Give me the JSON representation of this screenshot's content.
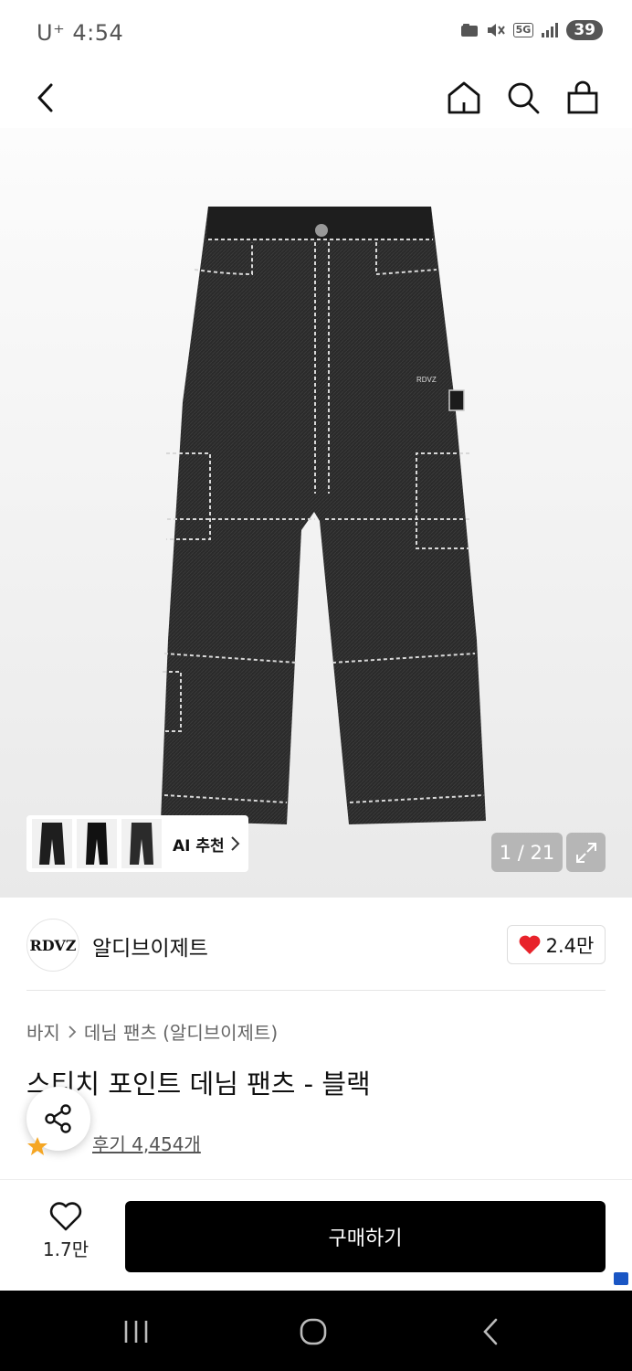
{
  "status_bar": {
    "time": "U⁺ 4:54",
    "network": "5G",
    "battery": "39"
  },
  "header": {
    "back_icon": "chevron-left-icon",
    "home_icon": "home-icon",
    "search_icon": "search-icon",
    "bag_icon": "shopping-bag-icon"
  },
  "gallery": {
    "ai_recommend_label": "AI 추천",
    "counter": "1 / 21"
  },
  "brand": {
    "logo_text": "RDVZ",
    "name": "알디브이제트",
    "likes": "2.4만"
  },
  "breadcrumb": {
    "category": "바지",
    "subcategory": "데님 팬츠 (알디브이제트)"
  },
  "product": {
    "title": "스티치 포인트 데님 팬츠 - 블랙",
    "reviews": "후기 4,454개"
  },
  "bottom_bar": {
    "wish_count": "1.7만",
    "buy_label": "구매하기"
  },
  "colors": {
    "accent_black": "#000000",
    "heart_red": "#e8232b",
    "star_orange": "#f5a623"
  }
}
